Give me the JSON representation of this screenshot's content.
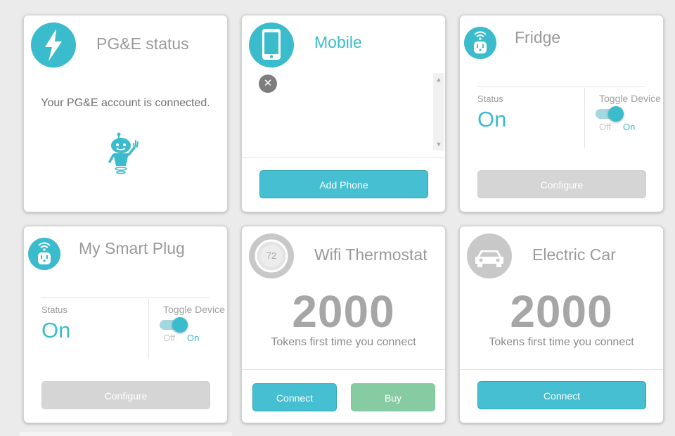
{
  "colors": {
    "accent": "#3bbccd",
    "button_teal": "#45bfd1",
    "button_grey": "#d5d5d5",
    "button_green": "#86cba1",
    "background": "#ebebeb"
  },
  "pge": {
    "icon": "lightning-icon",
    "title": "PG&E status",
    "message": "Your PG&E account is connected.",
    "mascot": "robot-mascot"
  },
  "mobile": {
    "icon": "smartphone-icon",
    "title": "Mobile",
    "remove_icon": "close-icon",
    "add_button": "Add Phone"
  },
  "fridge": {
    "icon": "smart-plug-icon",
    "title": "Fridge",
    "status_label": "Status",
    "status_value": "On",
    "toggle_label": "Toggle Device",
    "toggle_off": "Off",
    "toggle_on": "On",
    "toggle_state": "on",
    "configure_button": "Configure"
  },
  "plug": {
    "icon": "smart-plug-icon",
    "title": "My Smart Plug",
    "status_label": "Status",
    "status_value": "On",
    "toggle_label": "Toggle Device",
    "toggle_off": "Off",
    "toggle_on": "On",
    "toggle_state": "on",
    "configure_button": "Configure"
  },
  "thermostat": {
    "icon": "thermostat-icon",
    "icon_value": "72",
    "title": "Wifi Thermostat",
    "tokens": "2000",
    "tokens_caption": "Tokens first time you connect",
    "connect_button": "Connect",
    "buy_button": "Buy"
  },
  "car": {
    "icon": "car-icon",
    "title": "Electric Car",
    "tokens": "2000",
    "tokens_caption": "Tokens first time you connect",
    "connect_button": "Connect"
  }
}
